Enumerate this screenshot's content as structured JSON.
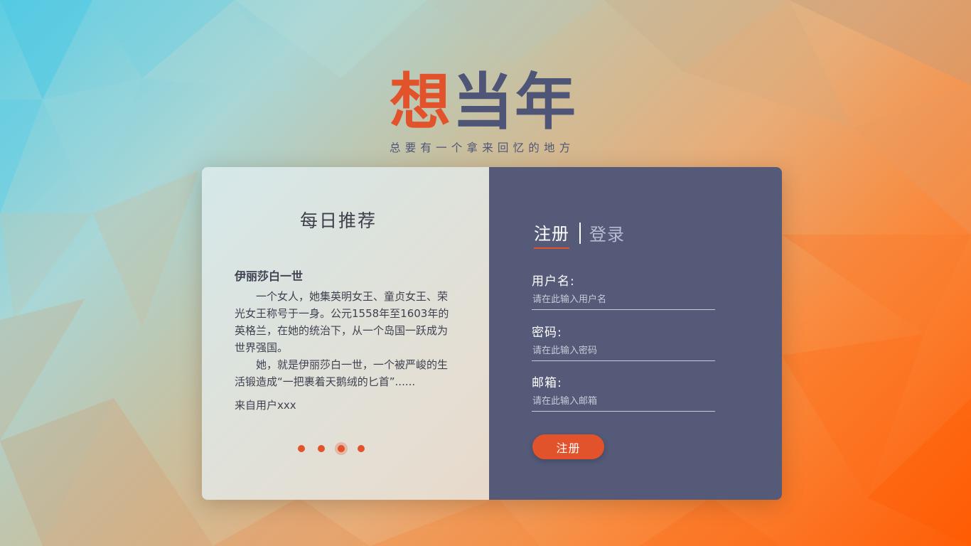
{
  "brand": {
    "title_first": "想",
    "title_rest": "当年",
    "subtitle": "总要有一个拿来回忆的地方"
  },
  "recommend": {
    "title": "每日推荐",
    "book": "伊丽莎白一世",
    "paragraphs": [
      "一个女人，她集英明女王、童贞女王、荣光女王称号于一身。公元1558年至1603年的英格兰，在她的统治下，从一个岛国一跃成为世界强国。",
      "她，就是伊丽莎白一世，一个被严峻的生活锻造成“一把裹着天鹅绒的匕首”......"
    ],
    "source": "来自用户xxx",
    "carousel": {
      "count": 4,
      "active_index": 2
    }
  },
  "form": {
    "tab_register": "注册",
    "tab_login": "登录",
    "username_label": "用户名:",
    "username_placeholder": "请在此输入用户名",
    "password_label": "密码:",
    "password_placeholder": "请在此输入密码",
    "email_label": "邮箱:",
    "email_placeholder": "请在此输入邮箱",
    "submit_label": "注册"
  },
  "colors": {
    "accent": "#e2532b",
    "panel_dark": "#545a78",
    "brand_dark": "#4f5577"
  }
}
